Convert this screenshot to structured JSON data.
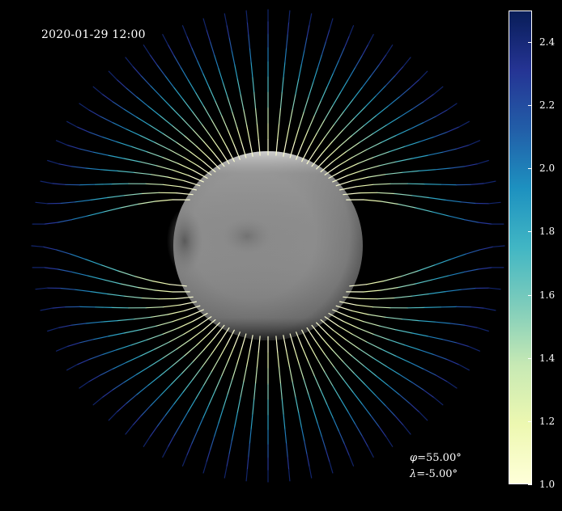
{
  "observation": {
    "timestamp": "2020-01-29  12:00",
    "phi_symbol": "φ",
    "phi_value": "=55.00°",
    "lambda_symbol": "λ",
    "lambda_value": "=-5.00°"
  },
  "colorbar": {
    "min": 1.0,
    "max": 2.5,
    "colormap": "YlGnBu",
    "colors": [
      "#ffffd9",
      "#edf8b1",
      "#c7e9b4",
      "#7fcdbb",
      "#41b6c4",
      "#1d91c0",
      "#225ea8",
      "#253494",
      "#081d58"
    ],
    "tick_labels": [
      "1.0",
      "1.2",
      "1.4",
      "1.6",
      "1.8",
      "2.0",
      "2.2",
      "2.4"
    ],
    "tick_values": [
      1.0,
      1.2,
      1.4,
      1.6,
      1.8,
      2.0,
      2.2,
      2.4
    ]
  },
  "scene": {
    "background": "#000000",
    "sphere_shading": "grayscale magnetogram"
  }
}
